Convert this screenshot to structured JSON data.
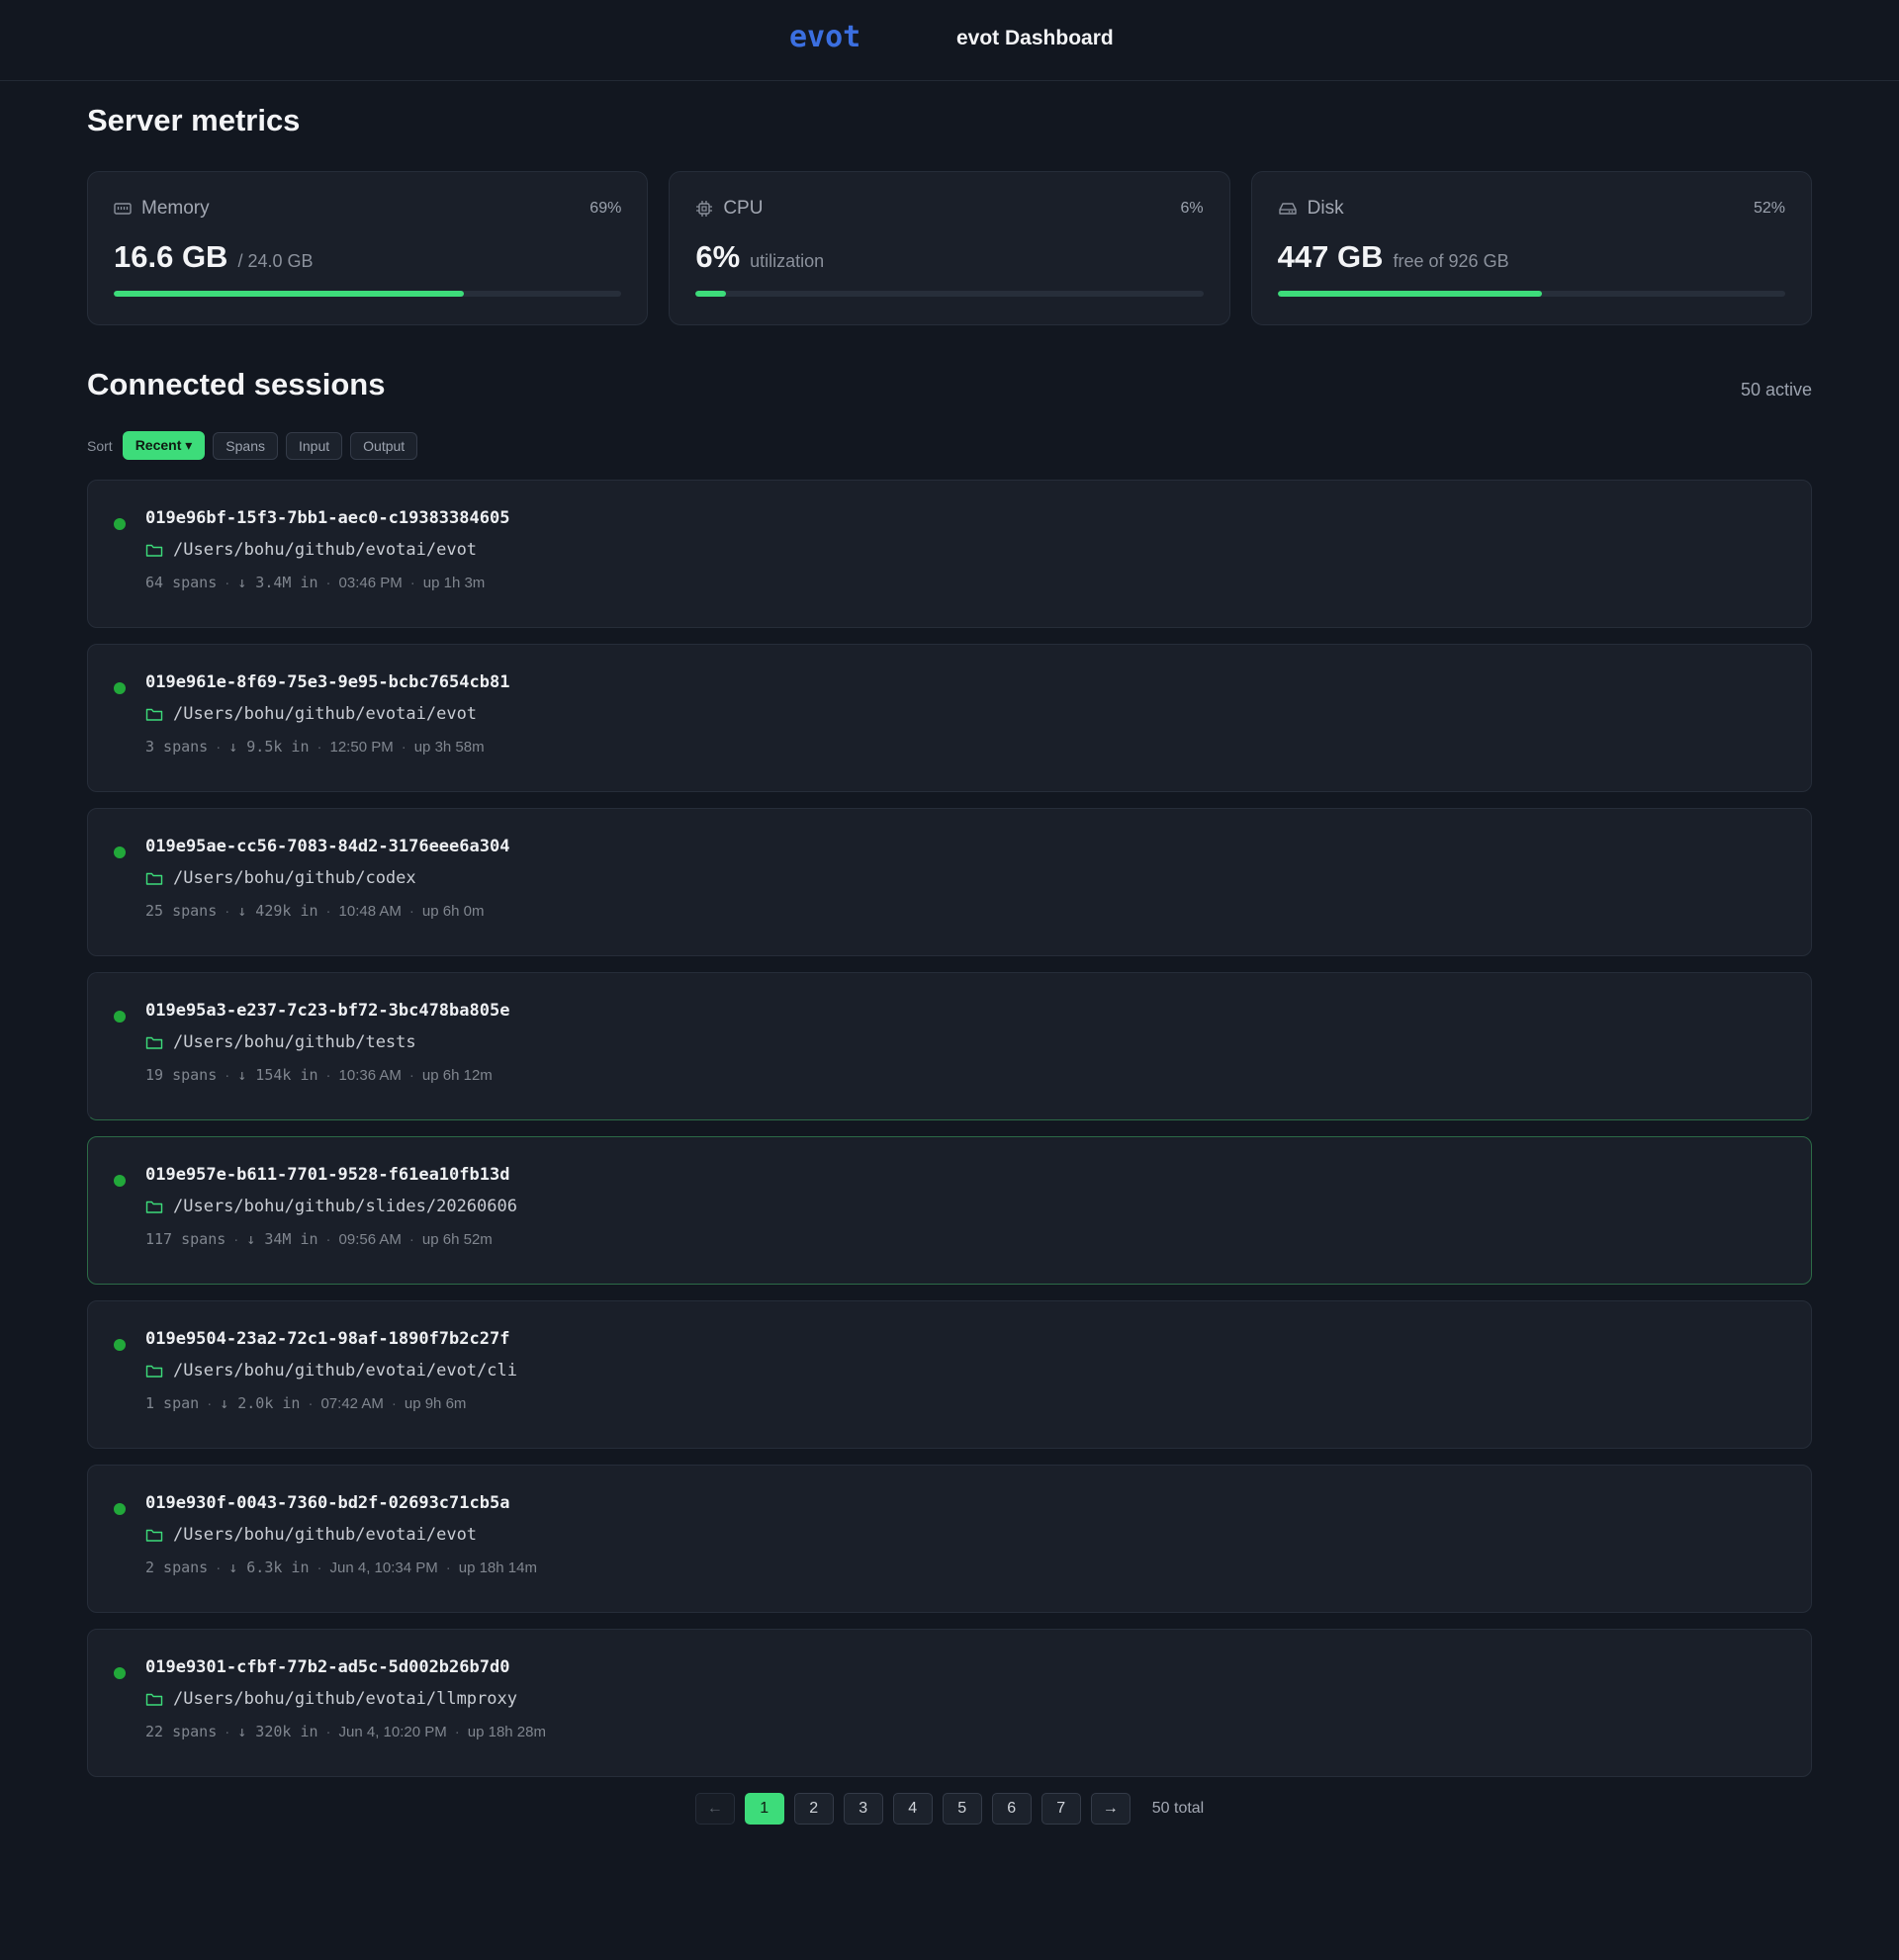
{
  "header": {
    "brand": "evot",
    "title": "evot Dashboard"
  },
  "metrics_section": {
    "title": "Server metrics",
    "cards": [
      {
        "label": "Memory",
        "icon": "memory-icon",
        "percent_text": "69%",
        "percent": 0.69,
        "value": "16.6 GB",
        "sub": "/ 24.0 GB"
      },
      {
        "label": "CPU",
        "icon": "cpu-icon",
        "percent_text": "6%",
        "percent": 0.06,
        "value": "6%",
        "sub": "utilization"
      },
      {
        "label": "Disk",
        "icon": "disk-icon",
        "percent_text": "52%",
        "percent": 0.52,
        "value": "447 GB",
        "sub": "free of 926 GB"
      }
    ]
  },
  "sessions": {
    "title": "Connected sessions",
    "active_count": "50 active",
    "sort_label": "Sort",
    "sort_options": [
      "Recent ▾",
      "Spans",
      "Input",
      "Output"
    ],
    "items": [
      {
        "id": "019e96bf-15f3-7bb1-aec0-c19383384605",
        "path": "/Users/bohu/github/evotai/evot",
        "spans": "64 spans",
        "input": "↓ 3.4M in",
        "time": "03:46 PM",
        "uptime": "up 1h 3m"
      },
      {
        "id": "019e961e-8f69-75e3-9e95-bcbc7654cb81",
        "path": "/Users/bohu/github/evotai/evot",
        "spans": "3 spans",
        "input": "↓ 9.5k in",
        "time": "12:50 PM",
        "uptime": "up 3h 58m"
      },
      {
        "id": "019e95ae-cc56-7083-84d2-3176eee6a304",
        "path": "/Users/bohu/github/codex",
        "spans": "25 spans",
        "input": "↓ 429k in",
        "time": "10:48 AM",
        "uptime": "up 6h 0m"
      },
      {
        "id": "019e95a3-e237-7c23-bf72-3bc478ba805e",
        "path": "/Users/bohu/github/tests",
        "spans": "19 spans",
        "input": "↓ 154k in",
        "time": "10:36 AM",
        "uptime": "up 6h 12m"
      },
      {
        "id": "019e957e-b611-7701-9528-f61ea10fb13d",
        "path": "/Users/bohu/github/slides/20260606",
        "spans": "117 spans",
        "input": "↓ 34M in",
        "time": "09:56 AM",
        "uptime": "up 6h 52m"
      },
      {
        "id": "019e9504-23a2-72c1-98af-1890f7b2c27f",
        "path": "/Users/bohu/github/evotai/evot/cli",
        "spans": "1 span",
        "input": "↓ 2.0k in",
        "time": "07:42 AM",
        "uptime": "up 9h 6m"
      },
      {
        "id": "019e930f-0043-7360-bd2f-02693c71cb5a",
        "path": "/Users/bohu/github/evotai/evot",
        "spans": "2 spans",
        "input": "↓ 6.3k in",
        "time": "Jun 4, 10:34 PM",
        "uptime": "up 18h 14m"
      },
      {
        "id": "019e9301-cfbf-77b2-ad5c-5d002b26b7d0",
        "path": "/Users/bohu/github/evotai/llmproxy",
        "spans": "22 spans",
        "input": "↓ 320k in",
        "time": "Jun 4, 10:20 PM",
        "uptime": "up 18h 28m"
      }
    ]
  },
  "pagination": {
    "prev": "←",
    "next": "→",
    "pages": [
      "1",
      "2",
      "3",
      "4",
      "5",
      "6",
      "7"
    ],
    "current": "1",
    "total": "50 total"
  },
  "colors": {
    "accent": "#3ddc7a",
    "brand": "#3b6fe0",
    "status_dot": "#22a83a",
    "background": "#121720"
  }
}
